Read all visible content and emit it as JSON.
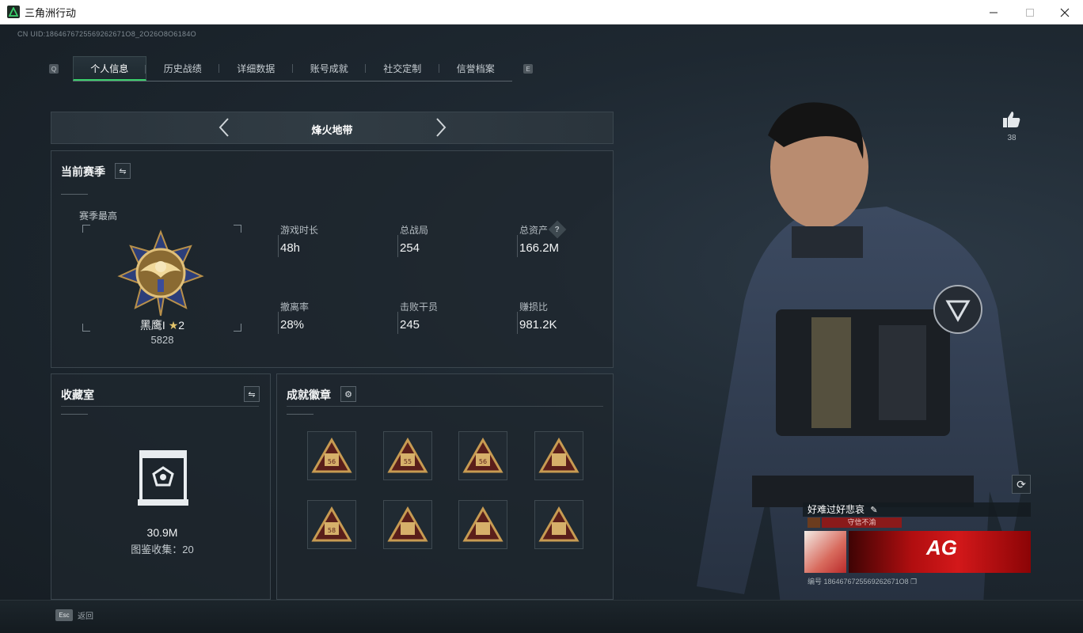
{
  "window": {
    "title": "三角洲行动"
  },
  "uid_text": "CN UID:1864676725569262671O8_2O26O8O6184O",
  "tabs": {
    "left_key": "Q",
    "right_key": "E",
    "items": [
      {
        "label": "个人信息"
      },
      {
        "label": "历史战绩"
      },
      {
        "label": "详细数据"
      },
      {
        "label": "账号成就"
      },
      {
        "label": "社交定制"
      },
      {
        "label": "信誉档案"
      }
    ]
  },
  "mode": {
    "label": "烽火地带"
  },
  "season": {
    "title": "当前赛季",
    "best_label": "赛季最高",
    "rank_name": "黑鹰I",
    "rank_stars": "2",
    "rank_score": "5828",
    "stats": [
      {
        "label": "游戏时长",
        "value": "48h"
      },
      {
        "label": "总战局",
        "value": "254"
      },
      {
        "label": "总资产",
        "value": "166.2M",
        "help": "?"
      },
      {
        "label": "撤离率",
        "value": "28%"
      },
      {
        "label": "击败干员",
        "value": "245"
      },
      {
        "label": "赚损比",
        "value": "981.2K"
      }
    ]
  },
  "collection": {
    "title": "收藏室",
    "value": "30.9M",
    "sub": "图鉴收集：20"
  },
  "achievements": {
    "title": "成就徽章",
    "medals": [
      "56",
      "55",
      "56",
      "",
      "58",
      "",
      "",
      ""
    ]
  },
  "like": {
    "count": "38"
  },
  "nameplate": {
    "name": "好难过好悲哀",
    "tag": "守信不渝",
    "banner_text": "AG",
    "id_text": "编号 1864676725569262671O8"
  },
  "footer": {
    "esc_key": "Esc",
    "esc_label": "返回"
  },
  "colors": {
    "accent_green": "#3bd06c",
    "banner_red": "#d3181a",
    "medal_gold": "#b8904a"
  }
}
